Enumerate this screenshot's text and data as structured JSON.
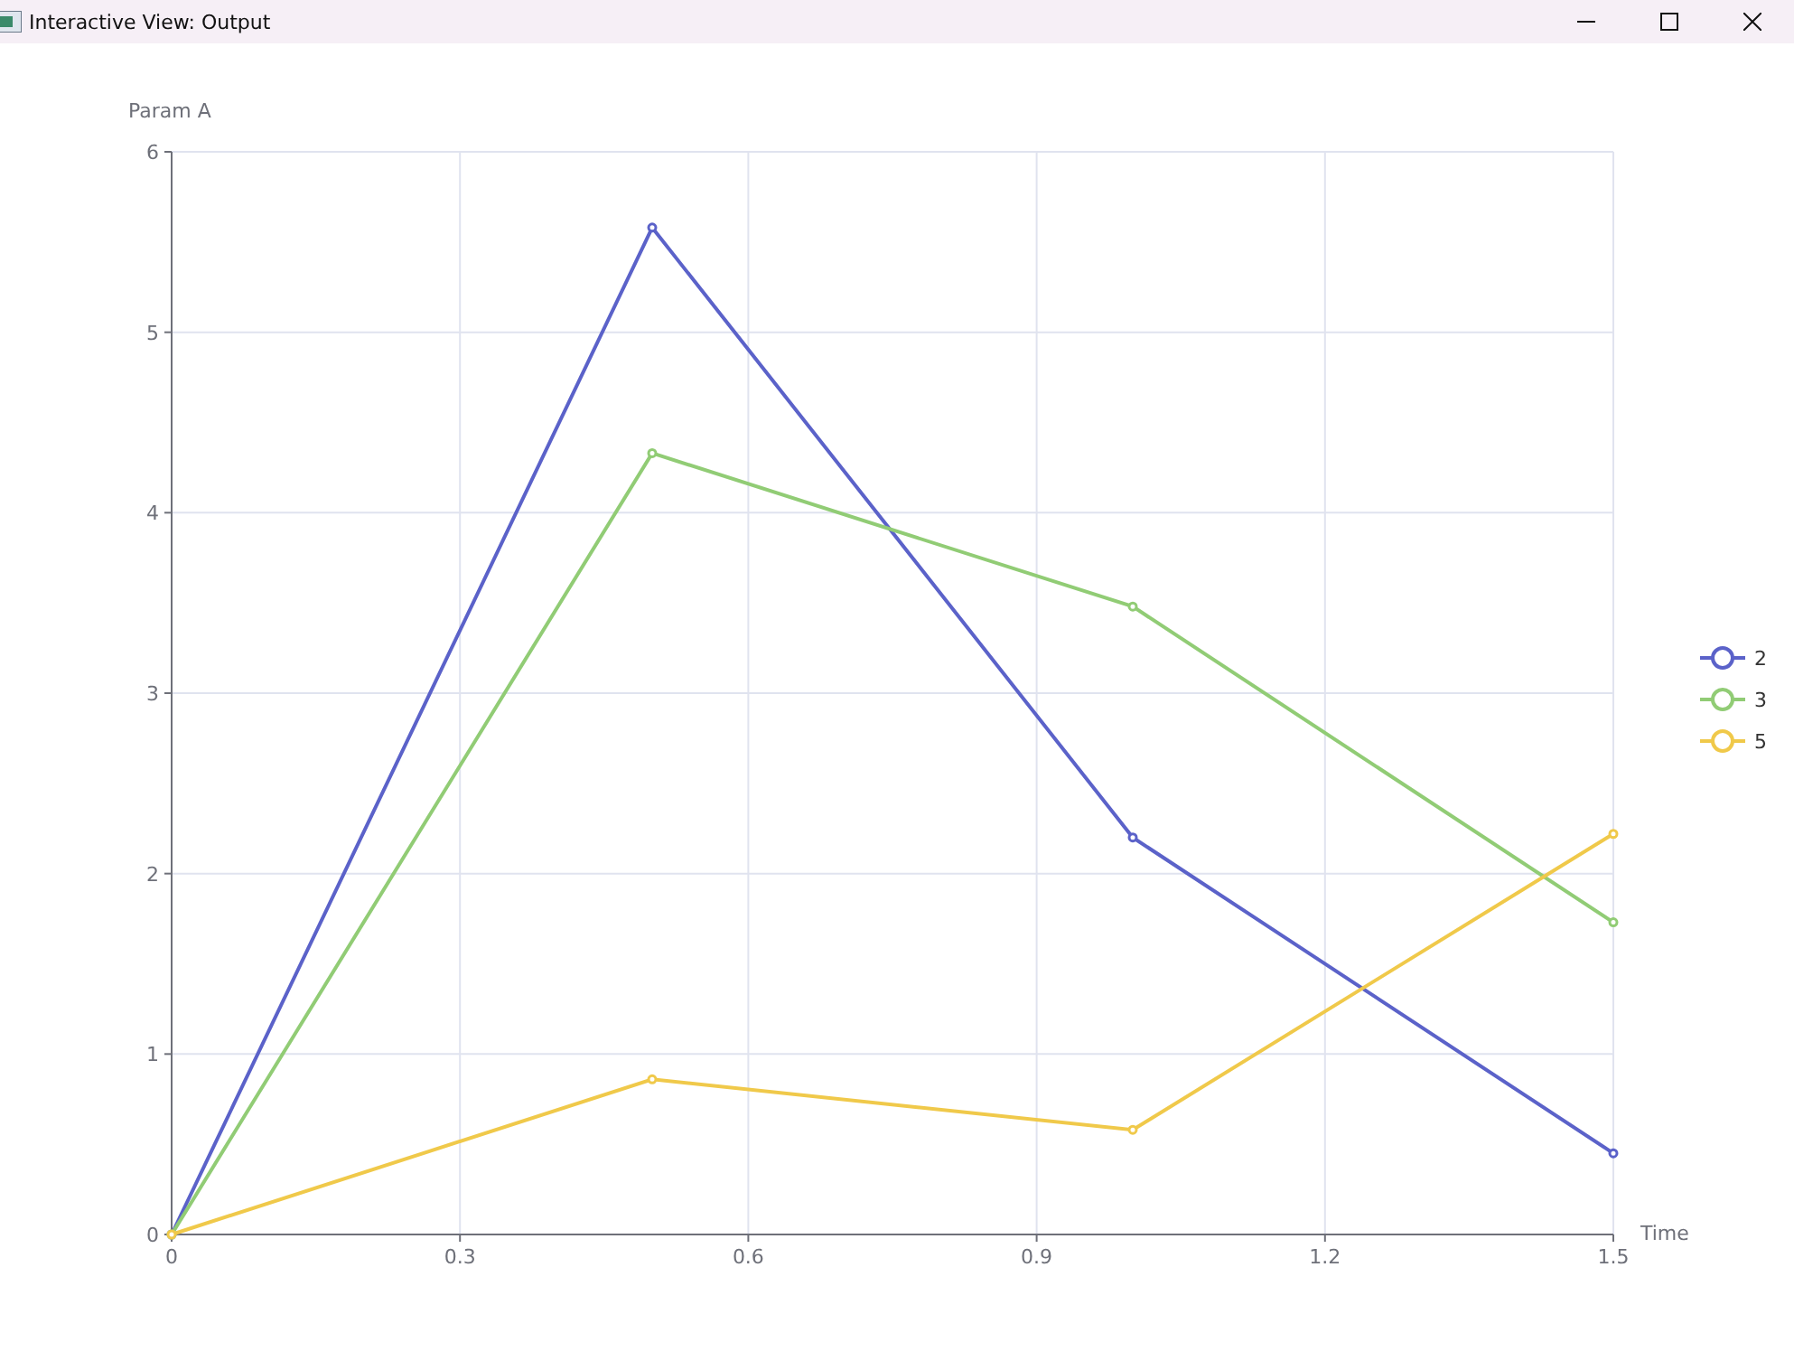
{
  "window": {
    "title": "Interactive View: Output"
  },
  "chart": {
    "chart_data": {
      "type": "line",
      "xlabel": "Time",
      "ylabel": "Param A",
      "x": [
        0,
        0.5,
        1.0,
        1.5
      ],
      "series": [
        {
          "name": "2",
          "color": "#5b62c9",
          "marker": "circle",
          "values": [
            0,
            5.58,
            2.2,
            0.45
          ]
        },
        {
          "name": "3",
          "color": "#91cc75",
          "marker": "circle",
          "values": [
            0,
            4.33,
            3.48,
            1.73
          ]
        },
        {
          "name": "5",
          "color": "#f0c94a",
          "marker": "circle",
          "values": [
            0,
            0.86,
            0.58,
            2.22
          ]
        }
      ],
      "xlim": [
        0,
        1.5
      ],
      "ylim": [
        0,
        6
      ],
      "xticks": [
        0,
        0.3,
        0.6,
        0.9,
        1.2,
        1.5
      ],
      "yticks": [
        0,
        1,
        2,
        3,
        4,
        5,
        6
      ],
      "grid": true,
      "legend": true
    }
  }
}
